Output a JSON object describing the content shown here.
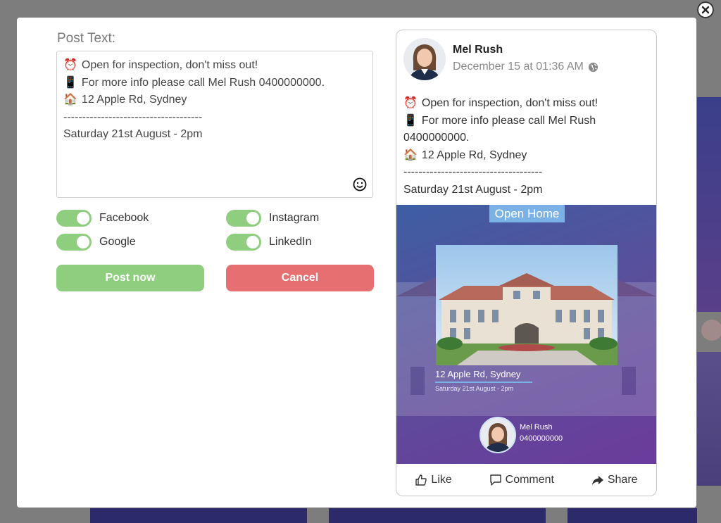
{
  "form": {
    "label": "Post Text:",
    "lines": [
      {
        "icon": "alarm-clock-icon",
        "text": "Open for inspection, don't miss out!"
      },
      {
        "icon": "mobile-phone-icon",
        "text": "For more info please call Mel Rush 0400000000."
      },
      {
        "icon": "house-icon",
        "text": "12 Apple Rd, Sydney"
      },
      {
        "icon": "",
        "text": "-------------------------------------"
      },
      {
        "icon": "",
        "text": "Saturday 21st August - 2pm"
      }
    ]
  },
  "toggles": {
    "facebook": "Facebook",
    "instagram": "Instagram",
    "google": "Google",
    "linkedin": "LinkedIn"
  },
  "buttons": {
    "post": "Post now",
    "cancel": "Cancel"
  },
  "preview": {
    "name": "Mel Rush",
    "date": "December 15 at 01:36 AM",
    "text_lines": [
      {
        "icon": "alarm-clock-icon",
        "text": "Open for inspection, don't miss out!"
      },
      {
        "icon": "mobile-phone-icon",
        "text": "For more info please call Mel Rush"
      },
      {
        "icon": "",
        "text": "0400000000."
      },
      {
        "icon": "house-icon",
        "text": "12 Apple Rd, Sydney"
      },
      {
        "icon": "",
        "text": "-------------------------------------"
      },
      {
        "icon": "",
        "text": "Saturday 21st August - 2pm"
      }
    ],
    "flyer": {
      "badge": "Open Home",
      "address": "12 Apple Rd, Sydney",
      "date": "Saturday 21st August - 2pm",
      "agent_name": "Mel Rush",
      "agent_phone": "0400000000"
    },
    "actions": {
      "like": "Like",
      "comment": "Comment",
      "share": "Share"
    }
  },
  "colors": {
    "toggle_on": "#8fce7f",
    "post_button": "#8fce7f",
    "cancel_button": "#e66f71",
    "badge": "#7bb2e6"
  }
}
